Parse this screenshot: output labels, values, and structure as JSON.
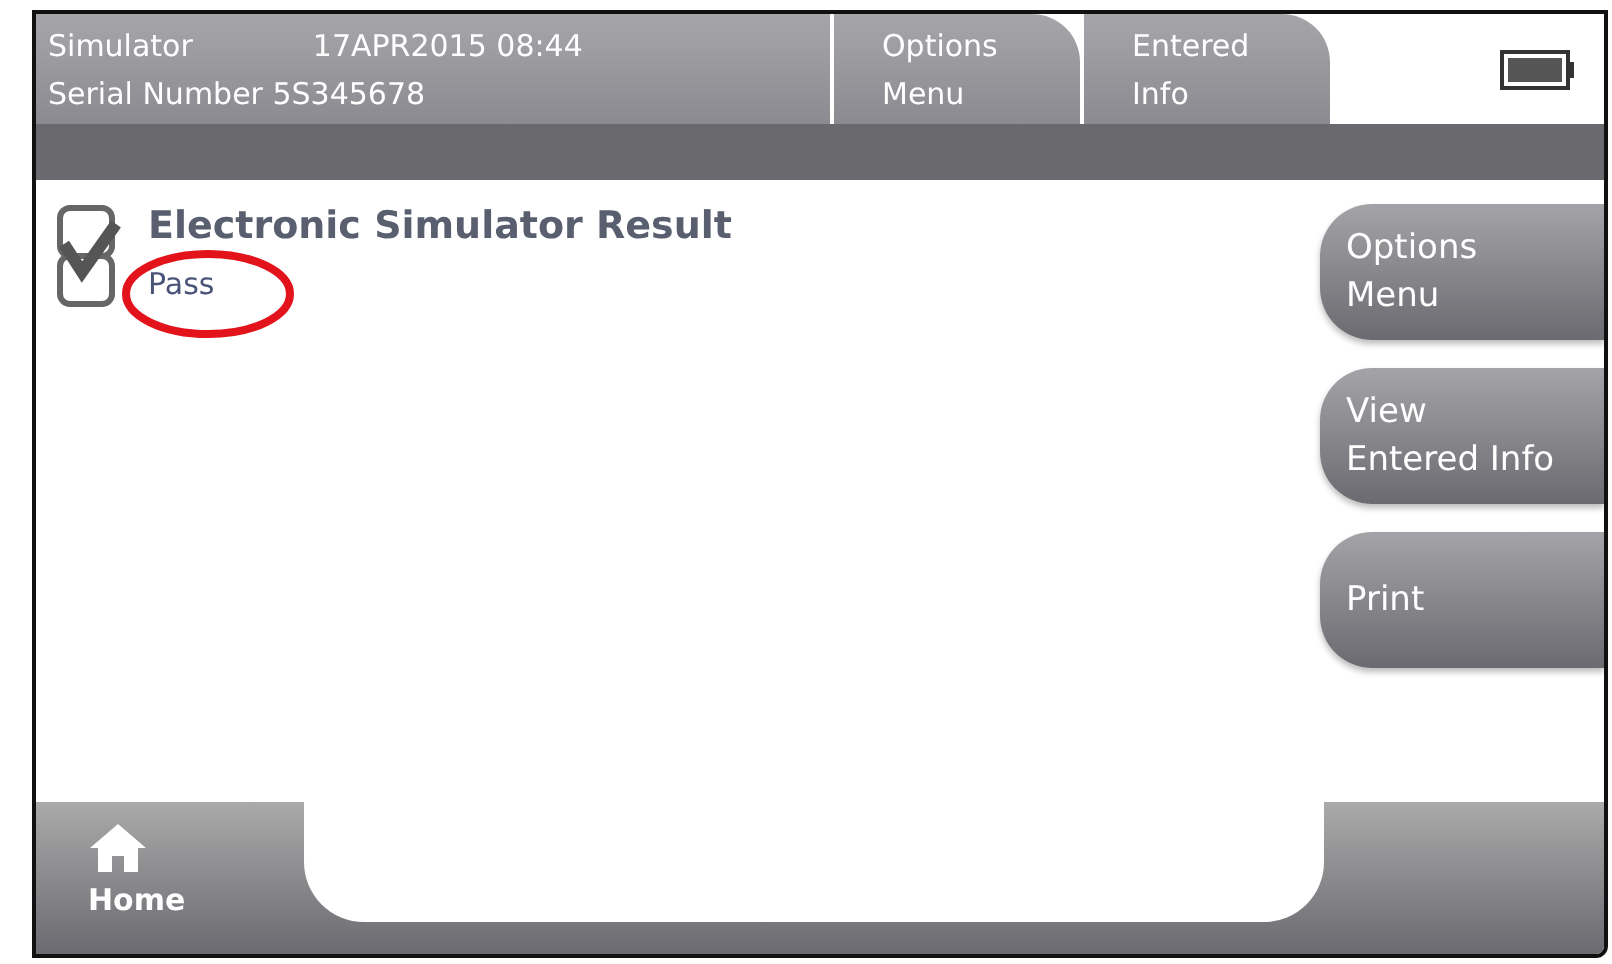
{
  "header": {
    "title": "Simulator",
    "datetime": "17APR2015 08:44",
    "serial": "Serial Number 5S345678"
  },
  "tabs": [
    {
      "label": "Options\nMenu",
      "selected": false
    },
    {
      "label": "Entered\nInfo",
      "selected": false
    }
  ],
  "result": {
    "title": "Electronic Simulator Result",
    "status": "Pass",
    "checked": true
  },
  "side_buttons": [
    "Options\nMenu",
    "View\nEntered Info",
    "Print"
  ],
  "footer": {
    "home": "Home"
  }
}
